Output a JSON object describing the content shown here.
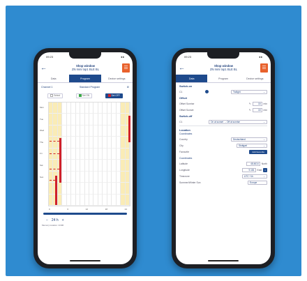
{
  "left_phone": {
    "status_time": "09:23",
    "status_icons": "●●",
    "title_line1": "Shop window",
    "title_line2": "ZN mini top1 BLE BL",
    "menu_glyph": "☰",
    "back_glyph": "←",
    "tabs": [
      "Data",
      "Program",
      "Device settings"
    ],
    "channel_label": "Channel 1",
    "program_label": "Standard Program",
    "modes": [
      "Select",
      "Set ON",
      "Set OFF"
    ],
    "days": [
      "Mon",
      "Tue",
      "Wed",
      "Thu",
      "Fri",
      "Sat",
      "Sun"
    ],
    "hours": [
      "0",
      "6",
      "12",
      "18",
      "24"
    ],
    "zoom_value": "24 h",
    "zoom_minus": "−",
    "zoom_plus": "+",
    "footer": "Memory location: 4/400"
  },
  "right_phone": {
    "status_time": "09:23",
    "status_icons": "●●",
    "title_line1": "Shop window",
    "title_line2": "ZN mini top1 BLE BL",
    "menu_glyph": "☰",
    "back_glyph": "←",
    "tabs": [
      "Data",
      "Program",
      "Device settings"
    ],
    "switch_on_label": "Switch-on",
    "c1_label": "C1",
    "twilight_value": "Twilight",
    "offset_label": "Offset",
    "offset_sunrise": "Offset Sunrise",
    "offset_sunset": "Offset Sunset",
    "offset_value": "15",
    "offset_unit": "min",
    "switchoff_label": "Switch-off",
    "switchoff_c1": "C1",
    "switchoff_value": "On at sunset → Off at sunrise",
    "location_label": "Location",
    "coordinates_label": "Coordinates",
    "country_label": "Country",
    "country_value": "Deutschland",
    "city_label": "City",
    "city_value": "Stuttgart",
    "favourite_label": "Favourite",
    "add_favourite": "Add favourite",
    "coords_sub_label": "Coordinates",
    "latitude_label": "Latitude",
    "latitude_value": "48.4614",
    "latitude_dir": "North",
    "longitude_label": "Longitude",
    "longitude_value": "9.181",
    "longitude_dir": "East",
    "timezone_label": "Timezone",
    "timezone_value": "UTC +1h",
    "summer_label": "Summer/Winter Sun",
    "summer_value": "Europe"
  },
  "colors": {
    "background": "#2f8bd0",
    "accent": "#1e4a8c",
    "menu_orange": "#e8612c",
    "on_red": "#d0202a",
    "grid_yellow": "#faecb6"
  }
}
